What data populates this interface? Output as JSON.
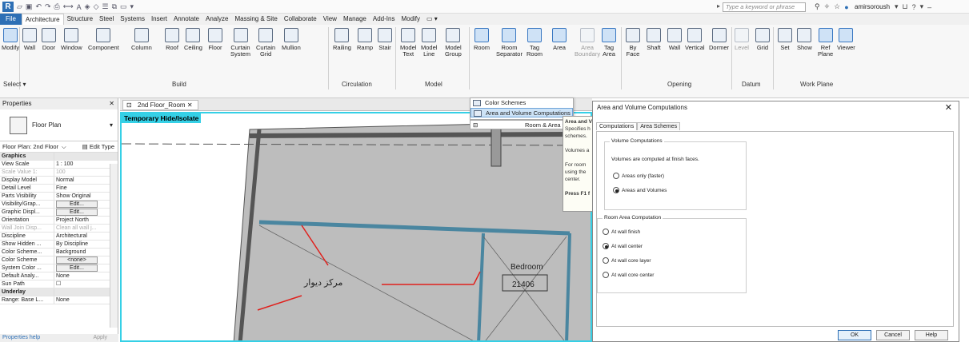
{
  "titlebar": {
    "search_placeholder": "Type a keyword or phrase",
    "user": "amirsoroush"
  },
  "tabs": [
    "File",
    "Architecture",
    "Structure",
    "Steel",
    "Systems",
    "Insert",
    "Annotate",
    "Analyze",
    "Massing & Site",
    "Collaborate",
    "View",
    "Manage",
    "Add-Ins",
    "Modify"
  ],
  "ribbon": {
    "buttons": [
      {
        "l1": "Modify",
        "l2": ""
      },
      {
        "l1": "Wall",
        "l2": ""
      },
      {
        "l1": "Door",
        "l2": ""
      },
      {
        "l1": "Window",
        "l2": ""
      },
      {
        "l1": "Component",
        "l2": ""
      },
      {
        "l1": "Column",
        "l2": ""
      },
      {
        "l1": "Roof",
        "l2": ""
      },
      {
        "l1": "Ceiling",
        "l2": ""
      },
      {
        "l1": "Floor",
        "l2": ""
      },
      {
        "l1": "Curtain",
        "l2": "System"
      },
      {
        "l1": "Curtain",
        "l2": "Grid"
      },
      {
        "l1": "Mullion",
        "l2": ""
      },
      {
        "l1": "Railing",
        "l2": ""
      },
      {
        "l1": "Ramp",
        "l2": ""
      },
      {
        "l1": "Stair",
        "l2": ""
      },
      {
        "l1": "Model",
        "l2": "Text"
      },
      {
        "l1": "Model",
        "l2": "Line"
      },
      {
        "l1": "Model",
        "l2": "Group"
      },
      {
        "l1": "Room",
        "l2": ""
      },
      {
        "l1": "Room",
        "l2": "Separator"
      },
      {
        "l1": "Tag",
        "l2": "Room"
      },
      {
        "l1": "Area",
        "l2": ""
      },
      {
        "l1": "Area",
        "l2": "Boundary"
      },
      {
        "l1": "Tag",
        "l2": "Area"
      },
      {
        "l1": "By",
        "l2": "Face"
      },
      {
        "l1": "Shaft",
        "l2": ""
      },
      {
        "l1": "Wall",
        "l2": ""
      },
      {
        "l1": "Vertical",
        "l2": ""
      },
      {
        "l1": "Dormer",
        "l2": ""
      },
      {
        "l1": "Level",
        "l2": ""
      },
      {
        "l1": "Grid",
        "l2": ""
      },
      {
        "l1": "Set",
        "l2": ""
      },
      {
        "l1": "Show",
        "l2": ""
      },
      {
        "l1": "Ref",
        "l2": "Plane"
      },
      {
        "l1": "Viewer",
        "l2": ""
      }
    ],
    "groups": {
      "select": "Select ▾",
      "build": "Build",
      "circulation": "Circulation",
      "model": "Model",
      "opening": "Opening",
      "datum": "Datum",
      "workplane": "Work Plane"
    }
  },
  "room_menu": {
    "item1": "Color Schemes",
    "item2": "Area and Volume Computations",
    "room_area": "Room & Area ▾"
  },
  "tooltip": {
    "t1": "Area and V",
    "t2": "Specifies h",
    "t3": "schemes.",
    "t4": "Volumes a",
    "t5": "For room",
    "t6": "using the",
    "t7": "center.",
    "t8": "Press F1 f"
  },
  "properties": {
    "title": "Properties",
    "type": "Floor Plan",
    "filter": "Floor Plan: 2nd Floor",
    "edit_type": "Edit Type",
    "rows": [
      {
        "k": "Graphics",
        "v": "",
        "cat": true
      },
      {
        "k": "View Scale",
        "v": "1 : 100"
      },
      {
        "k": "Scale Value    1:",
        "v": "100",
        "dim": true
      },
      {
        "k": "Display Model",
        "v": "Normal"
      },
      {
        "k": "Detail Level",
        "v": "Fine"
      },
      {
        "k": "Parts Visibility",
        "v": "Show Original"
      },
      {
        "k": "Visibility/Grap...",
        "v": "Edit...",
        "btn": true
      },
      {
        "k": "Graphic Displ...",
        "v": "Edit...",
        "btn": true
      },
      {
        "k": "Orientation",
        "v": "Project North"
      },
      {
        "k": "Wall Join Disp...",
        "v": "Clean all wall j...",
        "dim": true
      },
      {
        "k": "Discipline",
        "v": "Architectural"
      },
      {
        "k": "Show Hidden ...",
        "v": "By Discipline"
      },
      {
        "k": "Color Scheme...",
        "v": "Background"
      },
      {
        "k": "Color Scheme",
        "v": "<none>",
        "btn": true
      },
      {
        "k": "System Color ...",
        "v": "Edit...",
        "btn": true
      },
      {
        "k": "Default Analy...",
        "v": "None"
      },
      {
        "k": "Sun Path",
        "v": "☐"
      },
      {
        "k": "Underlay",
        "v": "",
        "cat": true
      },
      {
        "k": "Range: Base L...",
        "v": "None"
      }
    ],
    "help": "Properties help",
    "apply": "Apply"
  },
  "view": {
    "tab": "2nd Floor_Room",
    "temp": "Temporary Hide/Isolate",
    "room_name": "Bedroom",
    "room_num": "21406",
    "annotation": "مرکز دیوار"
  },
  "dialog": {
    "title": "Area and Volume Computations",
    "tab1": "Computations",
    "tab2": "Area Schemes",
    "vc_legend": "Volume Computations",
    "vc_text": "Volumes are computed at finish faces.",
    "vc_opt1": "Areas only (faster)",
    "vc_opt2": "Areas and Volumes",
    "ra_legend": "Room Area Computation",
    "ra_opt1": "At wall finish",
    "ra_opt2": "At wall center",
    "ra_opt3": "At wall core layer",
    "ra_opt4": "At wall core center",
    "ok": "OK",
    "cancel": "Cancel",
    "help": "Help"
  }
}
